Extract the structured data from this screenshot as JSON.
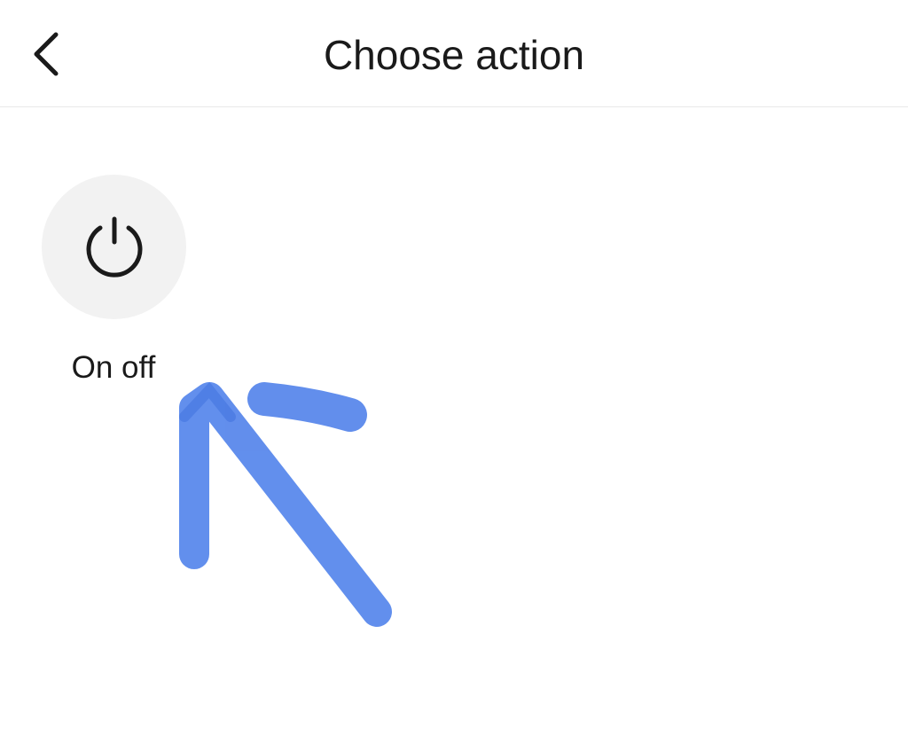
{
  "header": {
    "back_icon": "chevron-left-icon",
    "title": "Choose action"
  },
  "actions": [
    {
      "icon": "power-icon",
      "label": "On off"
    }
  ],
  "annotation": {
    "kind": "hand-drawn-arrow",
    "color": "#3b73e8"
  },
  "colors": {
    "background": "#ffffff",
    "text": "#1a1a1a",
    "icon_circle": "#f2f2f2",
    "divider": "#e9e9e9"
  }
}
